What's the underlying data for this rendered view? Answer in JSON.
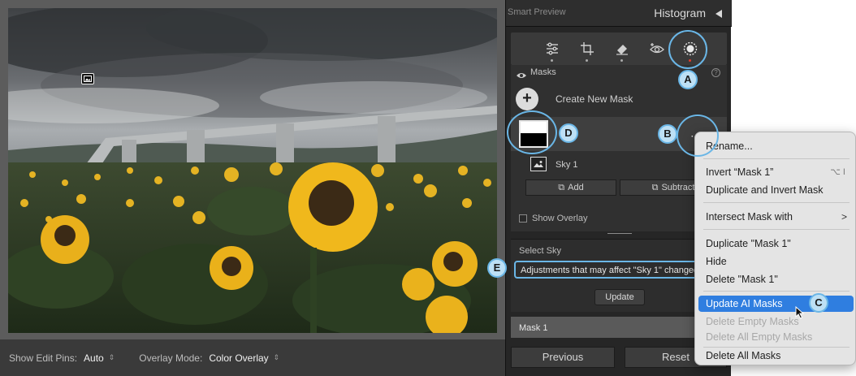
{
  "photo_panel": {
    "footer": {
      "show_edit_pins_label": "Show Edit Pins:",
      "show_edit_pins_value": "Auto",
      "overlay_mode_label": "Overlay Mode:",
      "overlay_mode_value": "Color Overlay"
    }
  },
  "right_panel": {
    "smart_preview": "Smart Preview",
    "histogram_title": "Histogram",
    "masks": {
      "title": "Masks",
      "create_new_mask": "Create New Mask",
      "mask_name": "1",
      "sky_component": "Sky 1",
      "add_label": "Add",
      "subtract_label": "Subtract",
      "show_overlay_label": "Show Overlay",
      "overlay_color": "#d13a2c"
    },
    "select_sky": {
      "title": "Select Sky",
      "notice": "Adjustments that may affect \"Sky 1\" changed.",
      "update_label": "Update"
    },
    "mask1_section": "Mask 1",
    "previous_label": "Previous",
    "reset_label": "Reset"
  },
  "context_menu": {
    "items": [
      {
        "label": "Rename...",
        "state": "normal"
      },
      {
        "label": "Invert “Mask 1”",
        "shortcut": "⌥ I",
        "state": "normal"
      },
      {
        "label": "Duplicate and Invert Mask",
        "state": "normal"
      },
      {
        "label": "Intersect Mask with",
        "submenu": ">",
        "state": "normal"
      },
      {
        "label": "Duplicate \"Mask 1\"",
        "state": "normal"
      },
      {
        "label": "Hide",
        "state": "normal"
      },
      {
        "label": "Delete \"Mask 1\"",
        "state": "normal"
      },
      {
        "label": "Update AI Masks",
        "state": "highlighted"
      },
      {
        "label": "Delete Empty Masks",
        "state": "disabled"
      },
      {
        "label": "Delete All Empty Masks",
        "state": "disabled"
      },
      {
        "label": "Delete All Masks",
        "state": "normal"
      }
    ]
  },
  "callouts": {
    "a": "A",
    "b": "B",
    "c": "C",
    "d": "D",
    "e": "E"
  },
  "colors": {
    "accent_blue": "#6ab6e6",
    "menu_highlight": "#2f7ee0",
    "active_tool_dot": "#e43a2a"
  }
}
